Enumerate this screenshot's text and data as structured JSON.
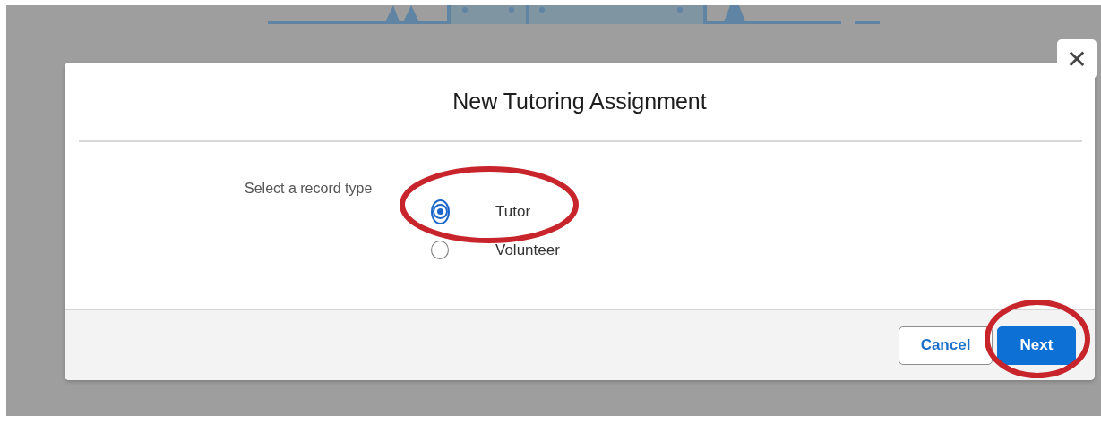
{
  "dialog": {
    "title": "New Tutoring Assignment",
    "close_label": "✕"
  },
  "record_type": {
    "label": "Select a record type",
    "options": [
      {
        "label": "Tutor",
        "selected": true
      },
      {
        "label": "Volunteer",
        "selected": false
      }
    ]
  },
  "buttons": [
    {
      "label": "Cancel",
      "kind": "secondary"
    },
    {
      "label": "Next",
      "kind": "primary"
    }
  ]
}
